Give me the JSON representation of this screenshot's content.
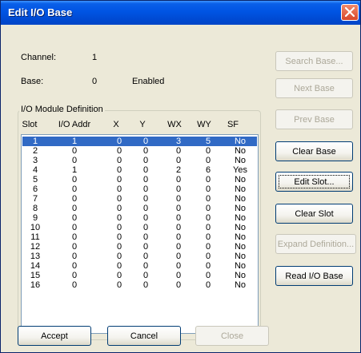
{
  "window": {
    "title": "Edit I/O Base"
  },
  "info": {
    "channel_label": "Channel:",
    "channel_value": "1",
    "base_label": "Base:",
    "base_value": "0",
    "base_status": "Enabled"
  },
  "group": {
    "caption": "I/O Module Definition",
    "columns": [
      "Slot",
      "I/O Addr",
      "X",
      "Y",
      "WX",
      "WY",
      "SF"
    ]
  },
  "rows": [
    [
      "1",
      "1",
      "0",
      "0",
      "3",
      "5",
      "No"
    ],
    [
      "2",
      "0",
      "0",
      "0",
      "0",
      "0",
      "No"
    ],
    [
      "3",
      "0",
      "0",
      "0",
      "0",
      "0",
      "No"
    ],
    [
      "4",
      "1",
      "0",
      "0",
      "2",
      "6",
      "Yes"
    ],
    [
      "5",
      "0",
      "0",
      "0",
      "0",
      "0",
      "No"
    ],
    [
      "6",
      "0",
      "0",
      "0",
      "0",
      "0",
      "No"
    ],
    [
      "7",
      "0",
      "0",
      "0",
      "0",
      "0",
      "No"
    ],
    [
      "8",
      "0",
      "0",
      "0",
      "0",
      "0",
      "No"
    ],
    [
      "9",
      "0",
      "0",
      "0",
      "0",
      "0",
      "No"
    ],
    [
      "10",
      "0",
      "0",
      "0",
      "0",
      "0",
      "No"
    ],
    [
      "11",
      "0",
      "0",
      "0",
      "0",
      "0",
      "No"
    ],
    [
      "12",
      "0",
      "0",
      "0",
      "0",
      "0",
      "No"
    ],
    [
      "13",
      "0",
      "0",
      "0",
      "0",
      "0",
      "No"
    ],
    [
      "14",
      "0",
      "0",
      "0",
      "0",
      "0",
      "No"
    ],
    [
      "15",
      "0",
      "0",
      "0",
      "0",
      "0",
      "No"
    ],
    [
      "16",
      "0",
      "0",
      "0",
      "0",
      "0",
      "No"
    ]
  ],
  "selected_slot": "1",
  "buttons": {
    "search_base": "Search Base...",
    "next_base": "Next Base",
    "prev_base": "Prev Base",
    "clear_base": "Clear Base",
    "edit_slot": "Edit Slot...",
    "clear_slot": "Clear Slot",
    "expand_definition": "Expand Definition...",
    "read_io_base": "Read I/O Base",
    "accept": "Accept",
    "cancel": "Cancel",
    "close": "Close"
  },
  "colors": {
    "title_bar": "#0054e3",
    "selection": "#316ac5",
    "close_button": "#d8472a"
  }
}
